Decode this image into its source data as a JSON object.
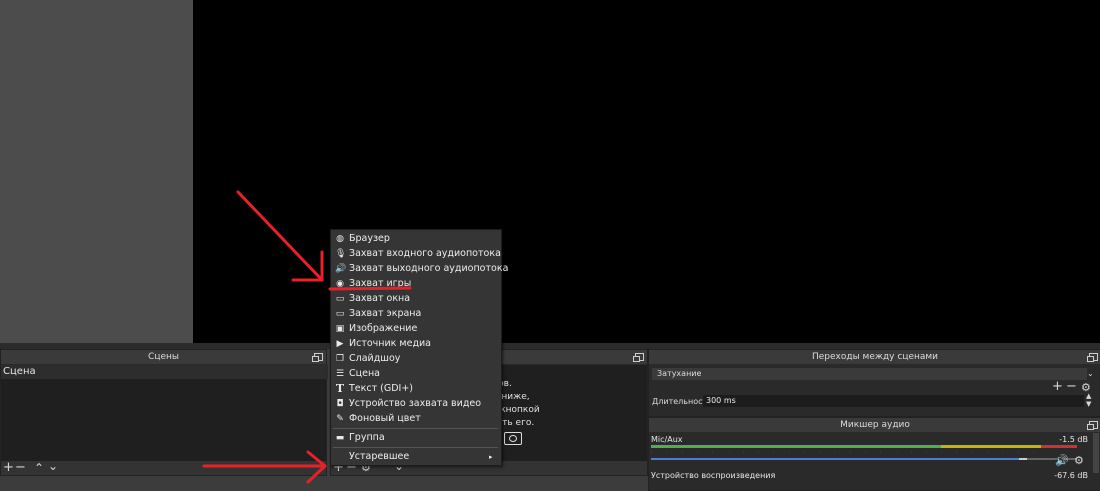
{
  "scenes": {
    "title": "Сцены",
    "items": [
      "Сцена"
    ]
  },
  "sources": {
    "hint_lines": [
      "ников.",
      "+ ниже,",
      "ой кнопкой",
      "вить его."
    ]
  },
  "transitions": {
    "title": "Переходы между сценами",
    "selected": "Затухание",
    "duration_label": "Длительность",
    "duration_value": "300 ms"
  },
  "mixer": {
    "title": "Микшер аудио",
    "ch1_name": "Mic/Aux",
    "ch1_db": "-1.5 dB",
    "ch2_name": "Устройство воспроизведения",
    "ch2_db": "-67.6 dB"
  },
  "context_menu": {
    "items": [
      {
        "label": "Браузер",
        "icon": "globe-icon"
      },
      {
        "label": "Захват входного аудиопотока",
        "icon": "microphone-icon"
      },
      {
        "label": "Захват выходного аудиопотока",
        "icon": "speaker-icon"
      },
      {
        "label": "Захват игры",
        "icon": "gamepad-icon"
      },
      {
        "label": "Захват окна",
        "icon": "window-icon"
      },
      {
        "label": "Захват экрана",
        "icon": "monitor-icon"
      },
      {
        "label": "Изображение",
        "icon": "image-icon"
      },
      {
        "label": "Источник медиа",
        "icon": "play-icon"
      },
      {
        "label": "Слайдшоу",
        "icon": "slideshow-icon"
      },
      {
        "label": "Сцена",
        "icon": "list-icon"
      },
      {
        "label": "Текст (GDI+)",
        "icon": "text-icon"
      },
      {
        "label": "Устройство захвата видео",
        "icon": "camera-icon"
      },
      {
        "label": "Фоновый цвет",
        "icon": "brush-icon"
      },
      {
        "label": "Группа",
        "icon": "folder-icon"
      },
      {
        "label": "Устаревшее",
        "icon": "submenu-arrow-icon"
      }
    ]
  },
  "colors": {
    "annotation": "#e8202a",
    "meter_green": "#4caf50",
    "meter_yellow": "#c8b400",
    "meter_red": "#d03030",
    "slider_blue": "#4a7fd0"
  }
}
